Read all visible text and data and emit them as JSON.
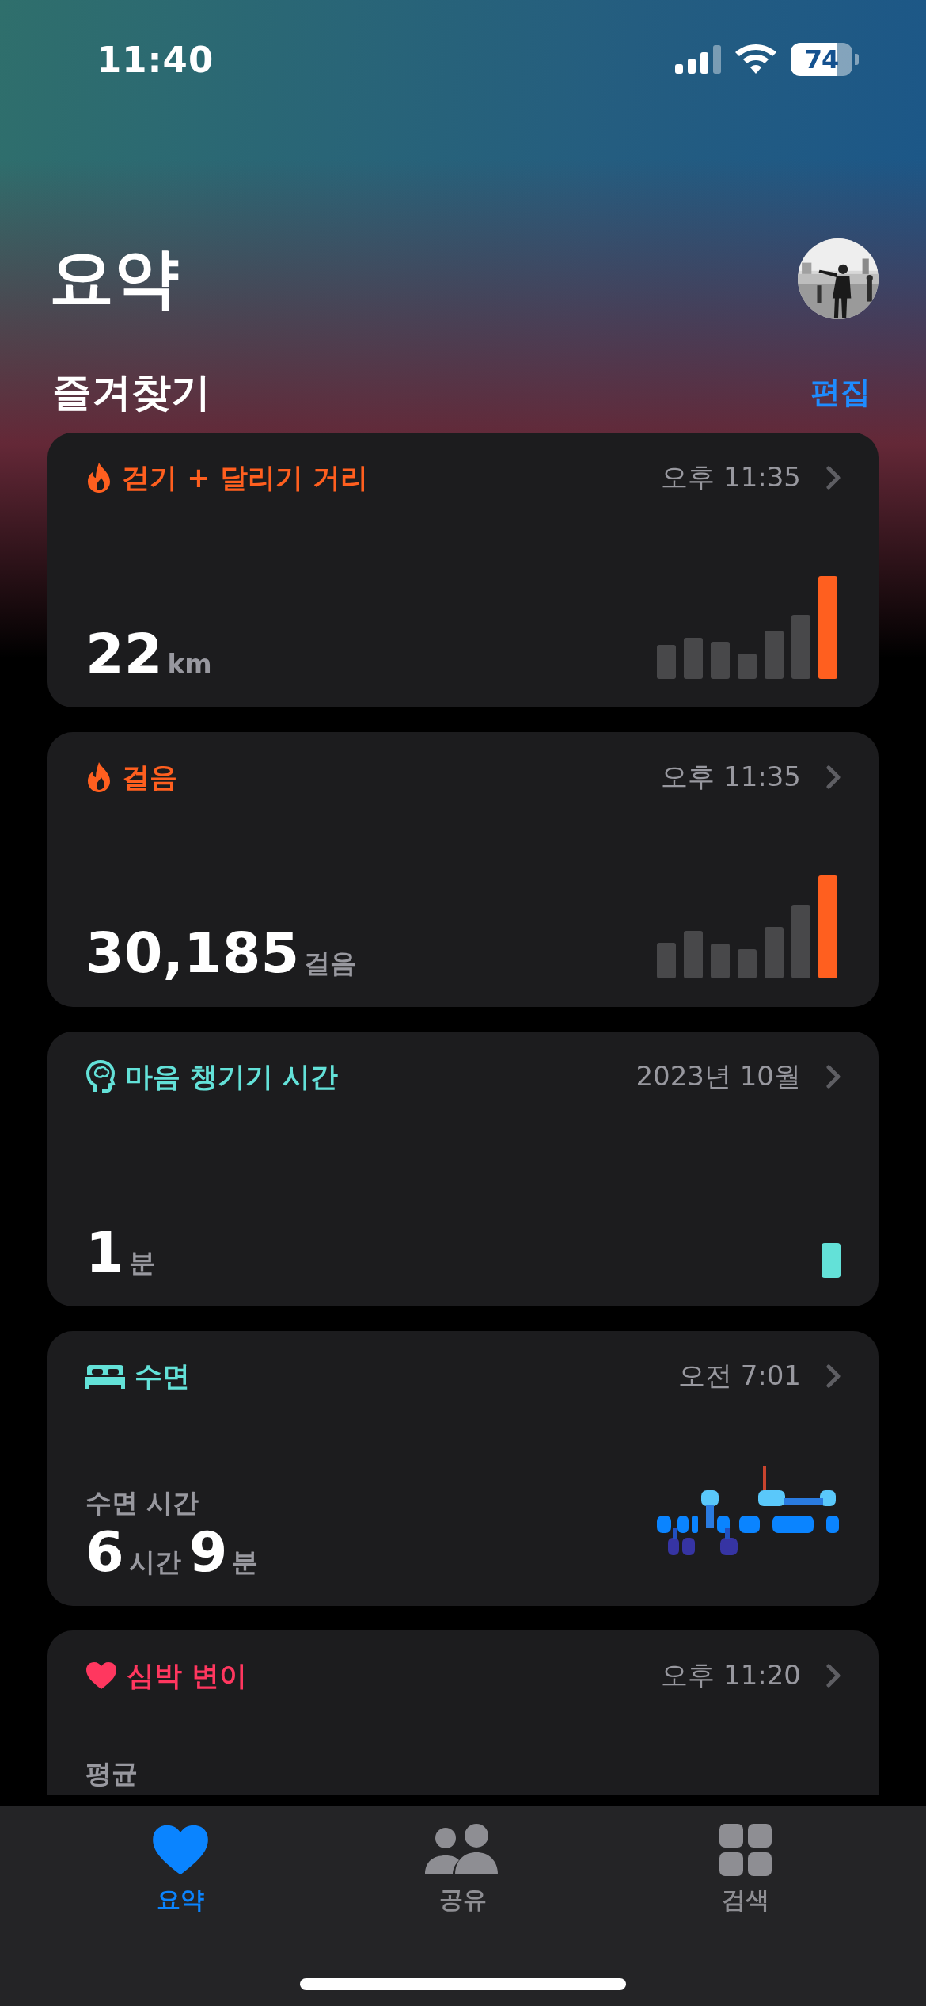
{
  "status_bar": {
    "time": "11:40",
    "battery": "74"
  },
  "header": {
    "title": "요약"
  },
  "favorites": {
    "title": "즐겨찾기",
    "edit": "편집"
  },
  "cards": [
    {
      "kind": "activity",
      "title": "걷기 + 달리기 거리",
      "color": "#ff5f1f",
      "time": "오후 11:35",
      "value": [
        {
          "number": "22",
          "unit": "km"
        }
      ]
    },
    {
      "kind": "activity",
      "title": "걸음",
      "color": "#ff5f1f",
      "time": "오후 11:35",
      "value": [
        {
          "number": "30,185",
          "unit": "걸음"
        }
      ]
    },
    {
      "kind": "mindfulness",
      "title": "마음 챙기기 시간",
      "color": "#63e1d8",
      "time": "2023년 10월",
      "value": [
        {
          "number": "1",
          "unit": "분"
        }
      ]
    },
    {
      "kind": "sleep",
      "title": "수면",
      "color": "#63e1d8",
      "time": "오전 7:01",
      "label": "수면 시간",
      "value": [
        {
          "number": "6",
          "unit": "시간"
        },
        {
          "number": "9",
          "unit": "분"
        }
      ]
    },
    {
      "kind": "heart",
      "title": "심박 변이",
      "color": "#ff375f",
      "time": "오후 11:20",
      "label": "평균"
    }
  ],
  "tabs": [
    {
      "label": "요약",
      "selected": true
    },
    {
      "label": "공유",
      "selected": false
    },
    {
      "label": "검색",
      "selected": false
    }
  ]
}
